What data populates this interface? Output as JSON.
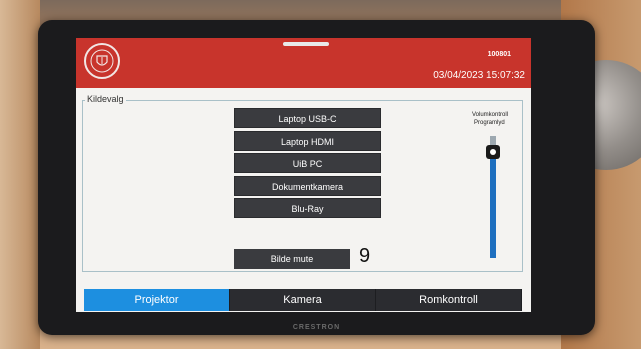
{
  "header": {
    "room_id": "100801",
    "datetime": "03/04/2023 15:07:32",
    "logo_icon": "university-seal-icon"
  },
  "source_panel": {
    "legend": "Kildevalg",
    "sources": [
      {
        "label": "Laptop USB-C"
      },
      {
        "label": "Laptop HDMI"
      },
      {
        "label": "UiB PC"
      },
      {
        "label": "Dokumentkamera"
      },
      {
        "label": "Blu-Ray"
      }
    ],
    "mute_button": "Bilde mute",
    "mute_value": "9"
  },
  "volume": {
    "label_line1": "Volumkontroll",
    "label_line2": "Programlyd",
    "level": 0.87
  },
  "tabs": [
    {
      "label": "Projektor",
      "active": true
    },
    {
      "label": "Kamera",
      "active": false
    },
    {
      "label": "Romkontroll",
      "active": false
    }
  ],
  "device_brand": "CRESTRON",
  "colors": {
    "header_red": "#c8342c",
    "active_tab_blue": "#1d8fe0",
    "button_dark": "#3a3b3f",
    "slider_blue": "#1e6fbf"
  }
}
